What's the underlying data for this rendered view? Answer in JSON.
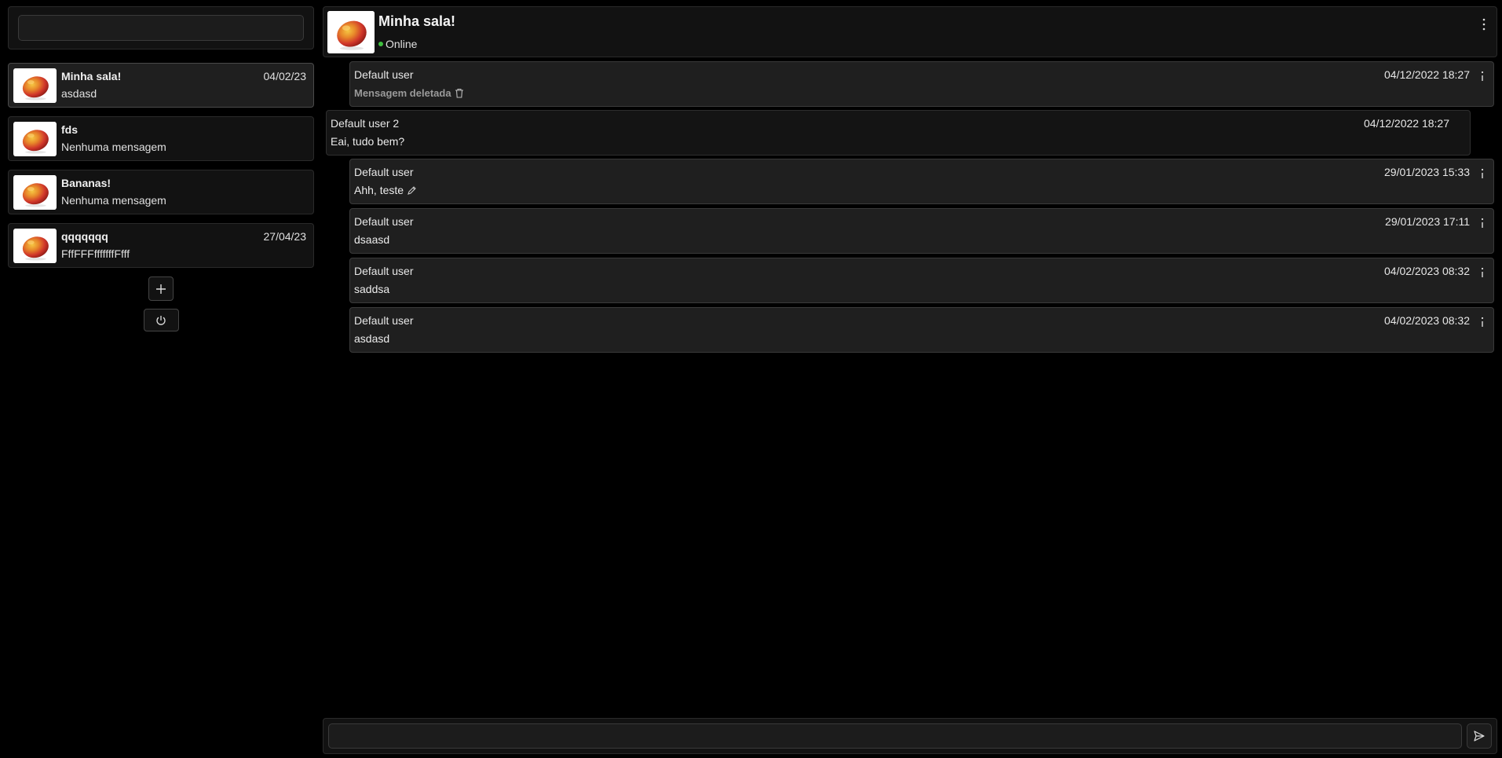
{
  "sidebar": {
    "search": {
      "value": "",
      "placeholder": ""
    },
    "rooms": [
      {
        "name": "Minha sala!",
        "last_message": "asdasd",
        "date": "04/02/23",
        "active": true
      },
      {
        "name": "fds",
        "last_message": "Nenhuma mensagem",
        "date": ""
      },
      {
        "name": "Bananas!",
        "last_message": "Nenhuma mensagem",
        "date": ""
      },
      {
        "name": "qqqqqqq",
        "last_message": "FffFFFfffffffFfff",
        "date": "27/04/23"
      }
    ],
    "add_button_icon": "plus-icon",
    "power_button_icon": "power-icon"
  },
  "chat": {
    "title": "Minha sala!",
    "status": "Online",
    "status_color": "#3fbf3f",
    "menu_icon": "vertical-dots-icon",
    "messages": [
      {
        "author": "Default user",
        "time": "04/12/2022 18:27",
        "text": "Mensagem deletada",
        "deleted": true,
        "mine": true
      },
      {
        "author": "Default user 2",
        "time": "04/12/2022 18:27",
        "text": "Eai, tudo bem?",
        "mine": false
      },
      {
        "author": "Default user",
        "time": "29/01/2023 15:33",
        "text": "Ahh, teste",
        "edited": true,
        "mine": true
      },
      {
        "author": "Default user",
        "time": "29/01/2023 17:11",
        "text": "dsaasd",
        "mine": true
      },
      {
        "author": "Default user",
        "time": "04/02/2023 08:32",
        "text": "saddsa",
        "mine": true
      },
      {
        "author": "Default user",
        "time": "04/02/2023 08:32",
        "text": "asdasd",
        "mine": true
      }
    ]
  },
  "composer": {
    "value": "",
    "placeholder": "",
    "send_icon": "send-icon"
  }
}
